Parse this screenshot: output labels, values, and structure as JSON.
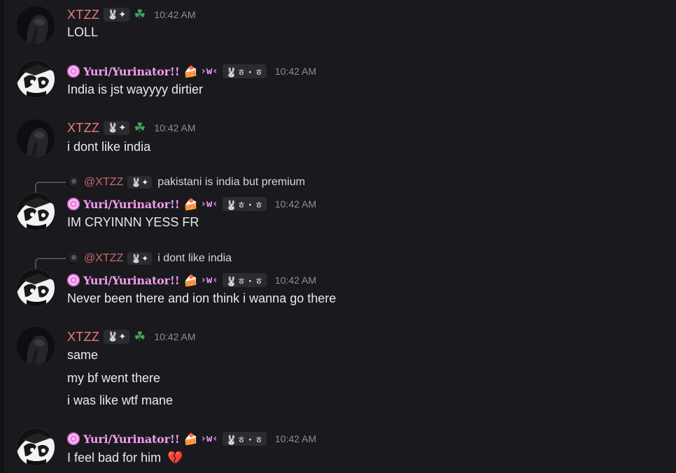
{
  "users": {
    "xtzz": {
      "name": "XTZZ",
      "tag": "🐰✦",
      "extra": "☘",
      "color": "#f07c7c"
    },
    "yuri": {
      "name": "Yuri/Yurinator!!",
      "cake": "🍰",
      "owo": "›w‹",
      "tag": "🐰ㅎ・ㅎ",
      "color": "#f49bf0"
    }
  },
  "messages": [
    {
      "author": "XTZZ",
      "time": "10:42 AM",
      "lines": [
        "LOLL"
      ]
    },
    {
      "author": "Yuri/Yurinator!!",
      "time": "10:42 AM",
      "lines": [
        "India is jst wayyyy dirtier"
      ]
    },
    {
      "author": "XTZZ",
      "time": "10:42 AM",
      "lines": [
        "i dont like india"
      ]
    },
    {
      "author": "Yuri/Yurinator!!",
      "time": "10:42 AM",
      "reply": {
        "name": "@XTZZ",
        "text": "pakistani is india but premium"
      },
      "lines": [
        "IM CRYINNN YESS FR"
      ]
    },
    {
      "author": "Yuri/Yurinator!!",
      "time": "10:42 AM",
      "reply": {
        "name": "@XTZZ",
        "text": "i dont like india"
      },
      "lines": [
        "Never been there and ion think i wanna go there"
      ]
    },
    {
      "author": "XTZZ",
      "time": "10:42 AM",
      "lines": [
        "same",
        "my bf went there",
        "i was like wtf mane"
      ]
    },
    {
      "author": "Yuri/Yurinator!!",
      "time": "10:42 AM",
      "lines": [
        "I feel bad for him"
      ],
      "emoji": "💔"
    }
  ]
}
